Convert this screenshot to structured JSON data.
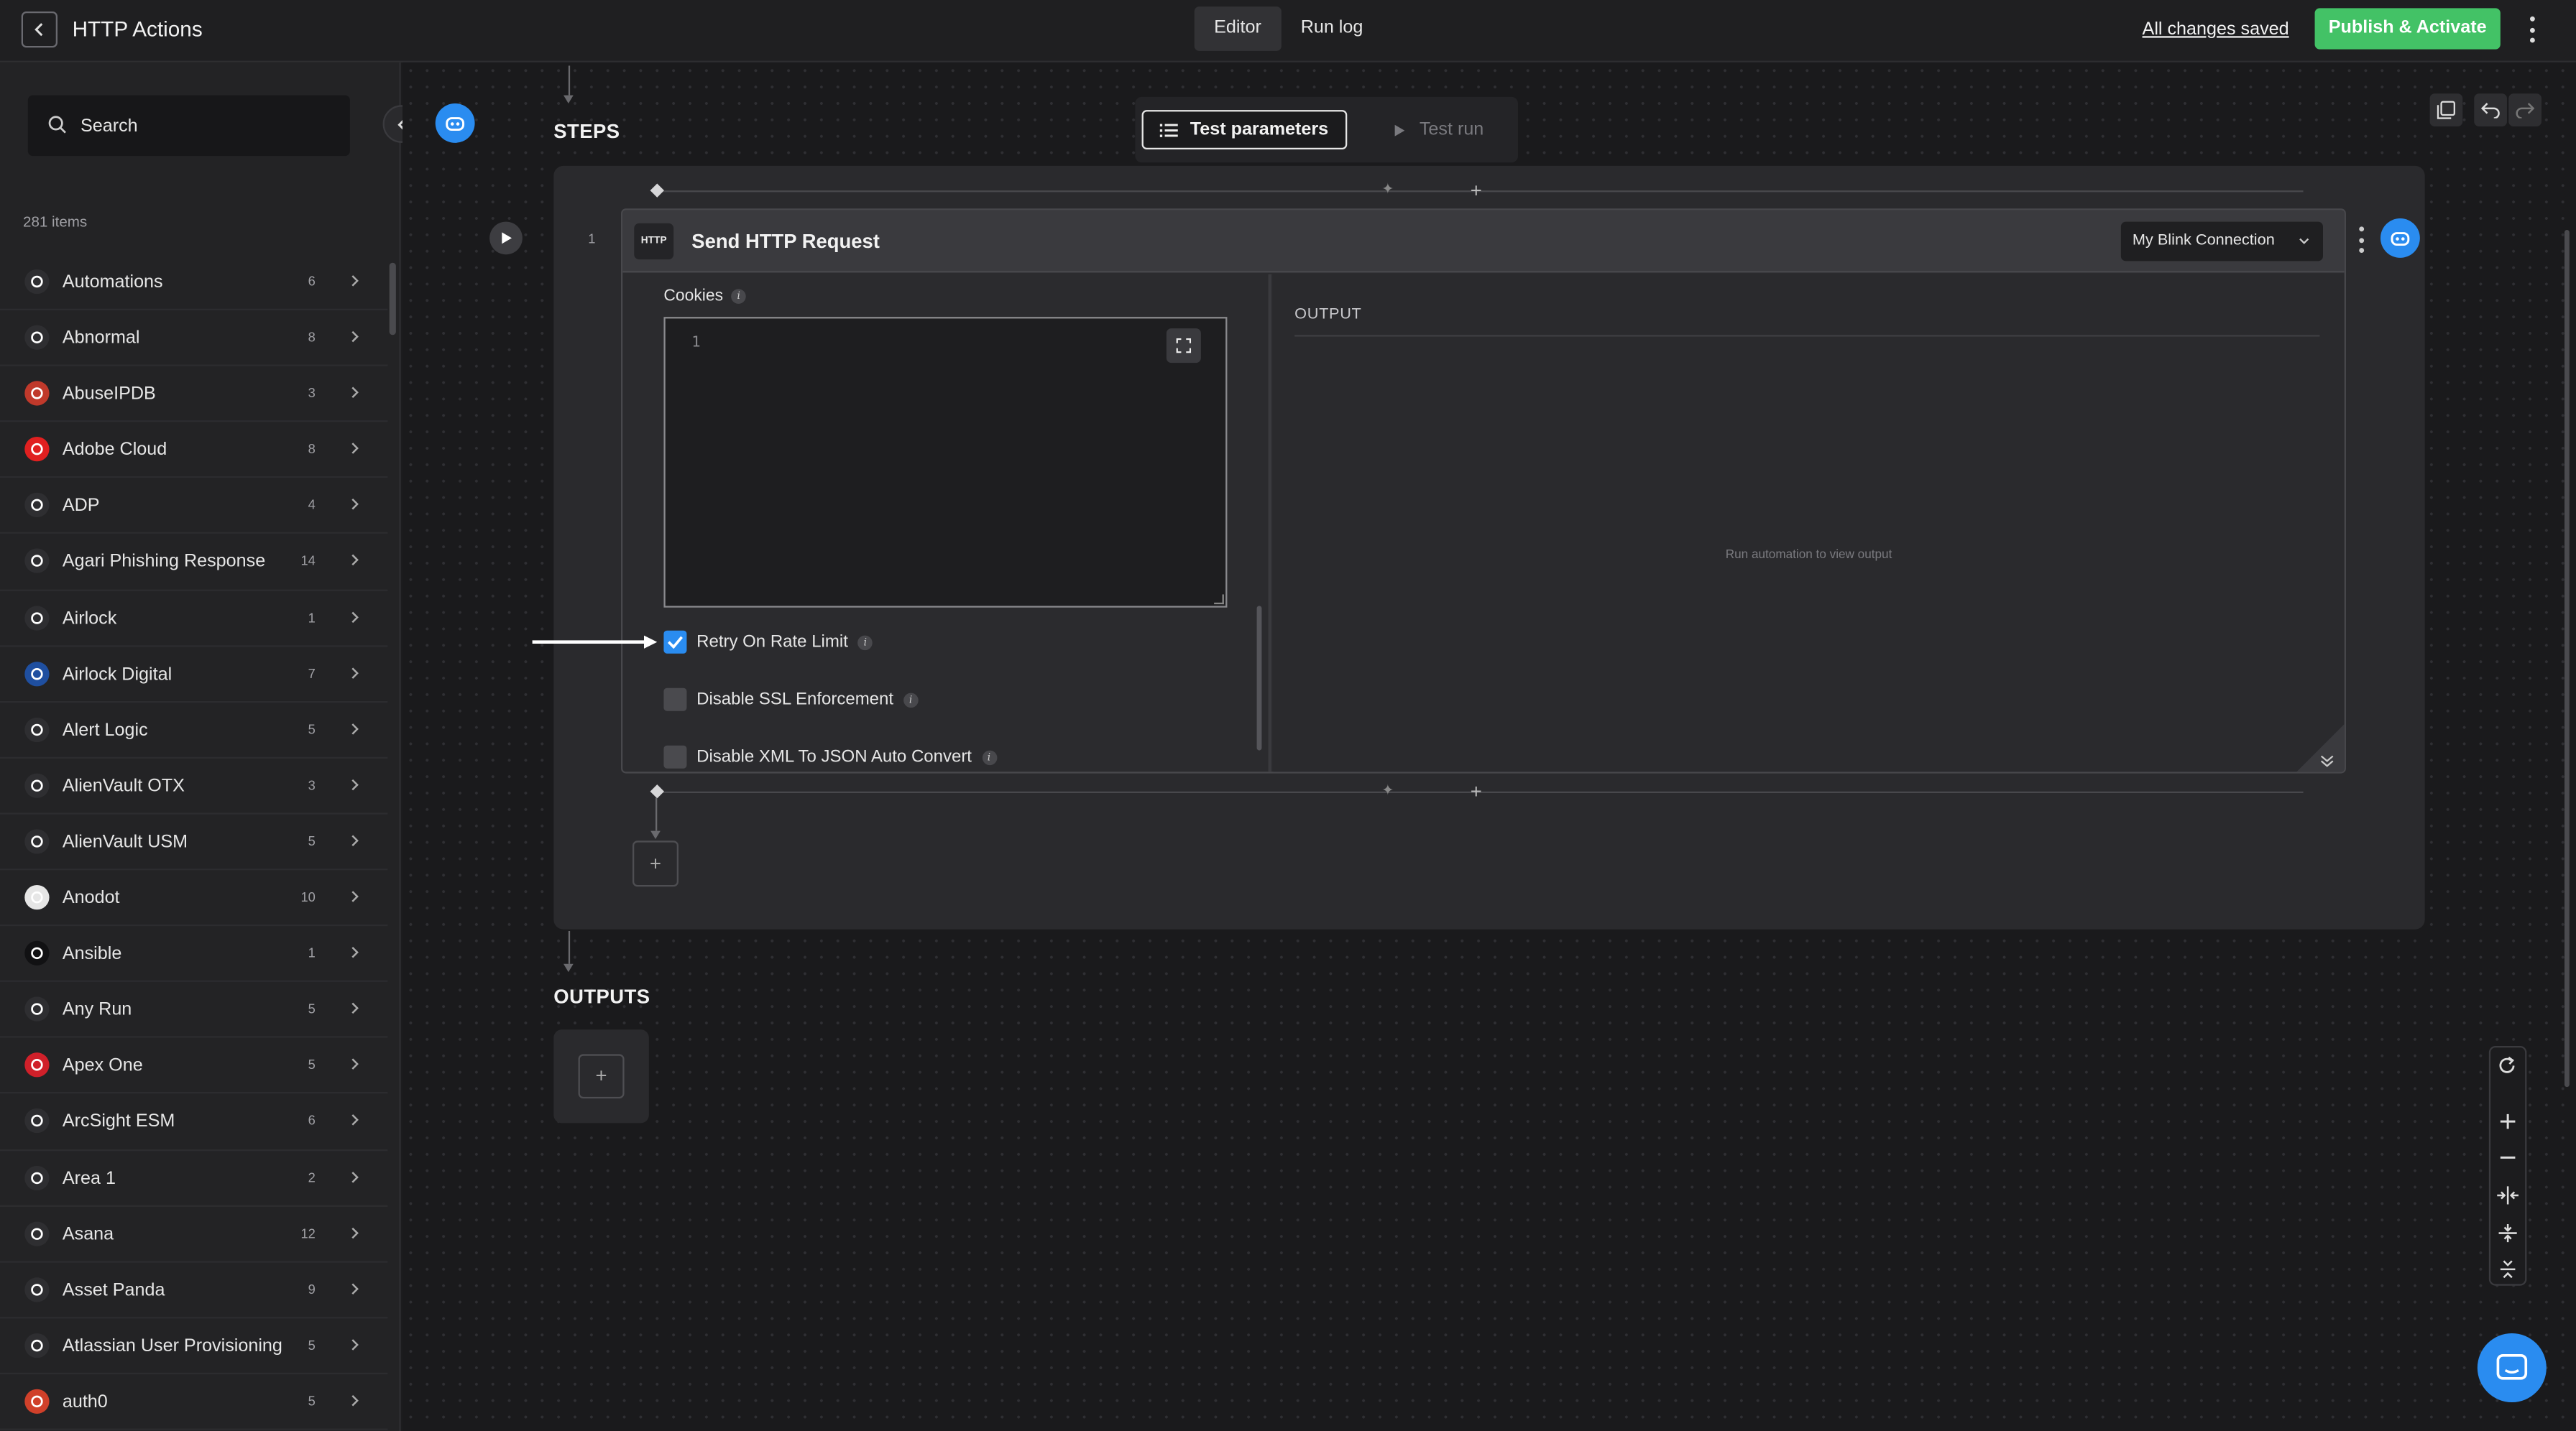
{
  "header": {
    "title": "HTTP Actions",
    "tabs": [
      {
        "label": "Editor",
        "active": true
      },
      {
        "label": "Run log",
        "active": false
      }
    ],
    "saved_status": "All changes saved",
    "publish_label": "Publish & Activate"
  },
  "sidebar": {
    "search_placeholder": "Search",
    "items_count": "281 items",
    "items": [
      {
        "name": "Automations",
        "count": "6",
        "logo_color": "#2e2e31",
        "icon": "automations-icon"
      },
      {
        "name": "Abnormal",
        "count": "8",
        "logo_color": "#2e2e31",
        "icon": "abnormal-icon"
      },
      {
        "name": "AbuseIPDB",
        "count": "3",
        "logo_color": "#c0392b",
        "icon": "abuseipdb-icon"
      },
      {
        "name": "Adobe Cloud",
        "count": "8",
        "logo_color": "#e02020",
        "icon": "adobe-icon"
      },
      {
        "name": "ADP",
        "count": "4",
        "logo_color": "#2e2e31",
        "icon": "adp-icon"
      },
      {
        "name": "Agari Phishing Response",
        "count": "14",
        "logo_color": "#2e2e31",
        "icon": "agari-icon"
      },
      {
        "name": "Airlock",
        "count": "1",
        "logo_color": "#2e2e31",
        "icon": "airlock-icon"
      },
      {
        "name": "Airlock Digital",
        "count": "7",
        "logo_color": "#1f4fa0",
        "icon": "airlock-digital-icon"
      },
      {
        "name": "Alert Logic",
        "count": "5",
        "logo_color": "#2e2e31",
        "icon": "alert-logic-icon"
      },
      {
        "name": "AlienVault OTX",
        "count": "3",
        "logo_color": "#2e2e31",
        "icon": "alien-icon"
      },
      {
        "name": "AlienVault USM",
        "count": "5",
        "logo_color": "#2e2e31",
        "icon": "alien-icon"
      },
      {
        "name": "Anodot",
        "count": "10",
        "logo_color": "#e6e6e6",
        "icon": "anodot-icon"
      },
      {
        "name": "Ansible",
        "count": "1",
        "logo_color": "#111113",
        "icon": "ansible-icon"
      },
      {
        "name": "Any Run",
        "count": "5",
        "logo_color": "#2e2e31",
        "icon": "anyrun-icon"
      },
      {
        "name": "Apex One",
        "count": "5",
        "logo_color": "#d0202a",
        "icon": "apex-one-icon"
      },
      {
        "name": "ArcSight ESM",
        "count": "6",
        "logo_color": "#2e2e31",
        "icon": "arcsight-icon"
      },
      {
        "name": "Area 1",
        "count": "2",
        "logo_color": "#2e2e31",
        "icon": "cloud-icon"
      },
      {
        "name": "Asana",
        "count": "12",
        "logo_color": "#2e2e31",
        "icon": "asana-icon"
      },
      {
        "name": "Asset Panda",
        "count": "9",
        "logo_color": "#2e2e31",
        "icon": "panda-icon"
      },
      {
        "name": "Atlassian User Provisioning",
        "count": "5",
        "logo_color": "#2e2e31",
        "icon": "atlassian-icon"
      },
      {
        "name": "auth0",
        "count": "5",
        "logo_color": "#d0402a",
        "icon": "auth0-icon"
      }
    ]
  },
  "canvas": {
    "steps_label": "STEPS",
    "outputs_label": "OUTPUTS",
    "test_parameters_label": "Test parameters",
    "test_run_label": "Test run",
    "step": {
      "number": "1",
      "badge": "HTTP",
      "title": "Send HTTP Request",
      "connection": "My Blink Connection",
      "cookies_label": "Cookies",
      "editor_line": "1",
      "checkboxes": [
        {
          "label": "Retry On Rate Limit",
          "checked": true
        },
        {
          "label": "Disable SSL Enforcement",
          "checked": false
        },
        {
          "label": "Disable XML To JSON Auto Convert",
          "checked": false
        }
      ],
      "output_label": "OUTPUT",
      "output_empty": "Run automation to view output"
    },
    "add_symbol": "+"
  },
  "colors": {
    "accent": "#2a8cf0",
    "publish": "#43c266",
    "background": "#1c1c1e"
  }
}
